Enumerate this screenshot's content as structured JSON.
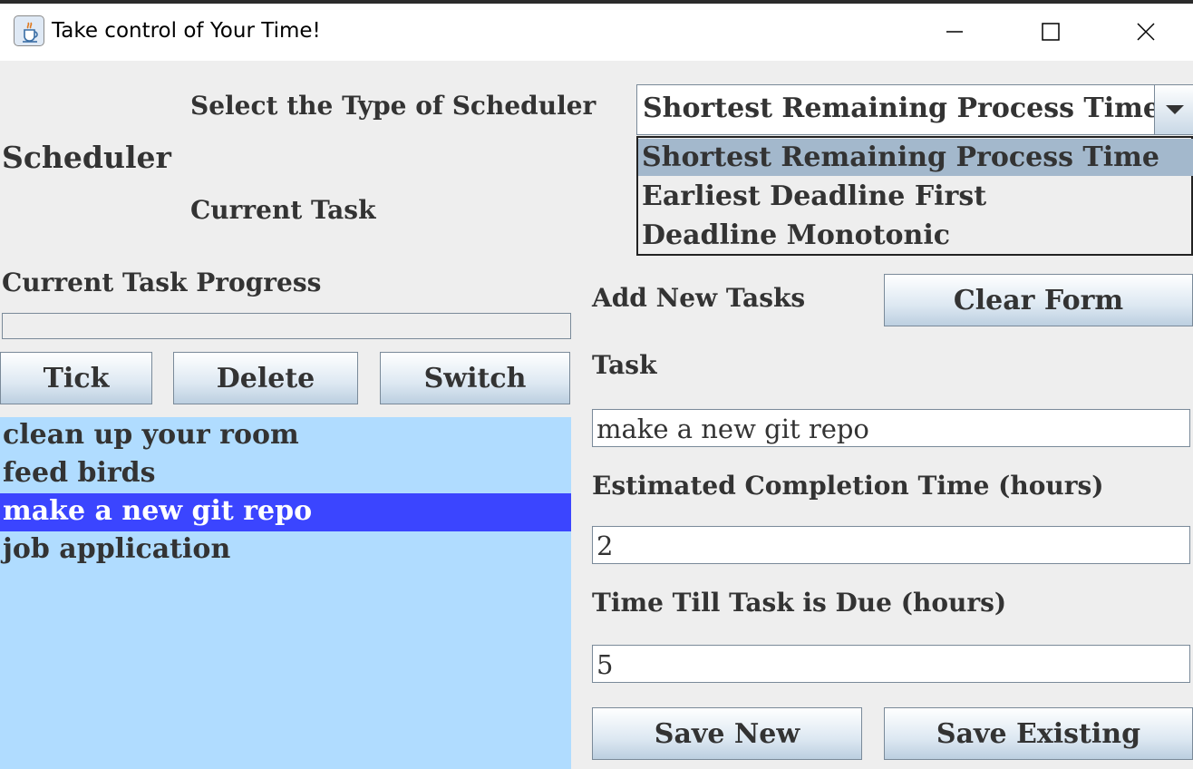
{
  "window": {
    "title": "Take control of Your Time!",
    "icon": "java-cup-icon",
    "controls": [
      "minimize-icon",
      "maximize-icon",
      "close-icon"
    ]
  },
  "scheduler": {
    "heading": "Scheduler",
    "select_label": "Select the Type of Scheduler",
    "selected": "Shortest Remaining Process Time",
    "options": [
      "Shortest Remaining Process Time",
      "Earliest Deadline First",
      "Deadline Monotonic"
    ],
    "highlighted_option_index": 0,
    "current_task_label": "Current Task",
    "current_task_value": ""
  },
  "progress": {
    "label": "Current Task Progress",
    "value": 0
  },
  "task_buttons": {
    "tick": "Tick",
    "delete": "Delete",
    "switch": "Switch"
  },
  "task_list": {
    "items": [
      "clean up your room",
      "feed birds",
      "make a new git repo",
      "job application"
    ],
    "selected_index": 2
  },
  "form": {
    "heading": "Add New Tasks",
    "clear_label": "Clear Form",
    "task_label": "Task",
    "task_value": "make a new git repo",
    "time_label": "Estimated Completion Time (hours)",
    "time_value": "2",
    "due_label": "Time Till Task is Due (hours)",
    "due_value": "5",
    "save_new_label": "Save New",
    "save_existing_label": "Save Existing"
  },
  "colors": {
    "background": "#eeeeee",
    "list_background": "#b0dcff",
    "list_selection": "#3b45ff",
    "dropdown_selection": "#a3b8cc",
    "text": "#333333"
  }
}
